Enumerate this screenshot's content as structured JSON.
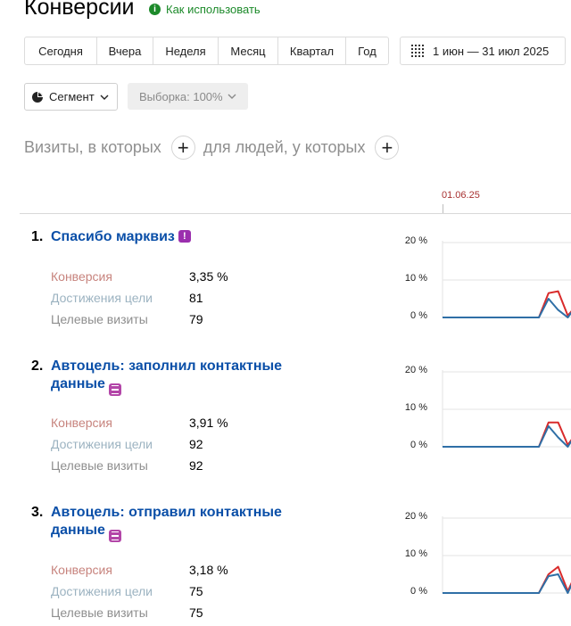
{
  "header": {
    "title": "Конверсии",
    "help_icon": "info-icon",
    "help_label": "Как использовать"
  },
  "periods": [
    "Сегодня",
    "Вчера",
    "Неделя",
    "Месяц",
    "Квартал",
    "Год"
  ],
  "date_range": {
    "icon": "calendar-icon",
    "label": "1 июн — 31 июл 2025"
  },
  "segment": {
    "icon": "pie-icon",
    "label": "Сегмент"
  },
  "sample": {
    "label": "Выборка: 100%"
  },
  "filter": {
    "visits_label": "Визиты, в которых",
    "people_label": "для людей, у которых",
    "add_symbol": "+"
  },
  "chart_header": {
    "first_date": "01.06.25"
  },
  "metric_labels": {
    "conversion": "Конверсия",
    "reaches": "Достижения цели",
    "visits": "Целевые визиты"
  },
  "colors": {
    "conversion_line": "#d92b2b",
    "visits_line": "#2f6fa6",
    "link": "#0a4fa8",
    "accent_green": "#1c8a2a"
  },
  "goals": [
    {
      "number": "1.",
      "name_lines": [
        "Спасибо марквиз"
      ],
      "badge": "!",
      "badge_icon": "alert-badge-icon",
      "conversion": "3,35 %",
      "reaches": "81",
      "visits": "79"
    },
    {
      "number": "2.",
      "name_lines": [
        "Автоцель: заполнил контактные",
        "данные"
      ],
      "badge": "",
      "badge_icon": "form-badge-icon",
      "conversion": "3,91 %",
      "reaches": "92",
      "visits": "92"
    },
    {
      "number": "3.",
      "name_lines": [
        "Автоцель: отправил контактные",
        "данные"
      ],
      "badge": "",
      "badge_icon": "form-badge-icon",
      "conversion": "3,18 %",
      "reaches": "75",
      "visits": "75"
    }
  ],
  "chart_data": [
    {
      "type": "line",
      "y_ticks": [
        "20 %",
        "10 %",
        "0 %"
      ],
      "ylim": [
        0,
        20
      ],
      "x": [
        1,
        2,
        3,
        4,
        5,
        6,
        7,
        8,
        9,
        10,
        11,
        12,
        13,
        14,
        15
      ],
      "series": [
        {
          "color": "#d92b2b",
          "values": [
            0,
            0,
            0,
            0,
            0,
            0,
            0,
            0,
            0,
            0,
            0,
            6.5,
            7,
            0.5,
            3.5
          ]
        },
        {
          "color": "#2f6fa6",
          "values": [
            0,
            0,
            0,
            0,
            0,
            0,
            0,
            0,
            0,
            0,
            0,
            5,
            2,
            0,
            3.5
          ]
        }
      ]
    },
    {
      "type": "line",
      "y_ticks": [
        "20 %",
        "10 %",
        "0 %"
      ],
      "ylim": [
        0,
        20
      ],
      "x": [
        1,
        2,
        3,
        4,
        5,
        6,
        7,
        8,
        9,
        10,
        11,
        12,
        13,
        14,
        15
      ],
      "series": [
        {
          "color": "#d92b2b",
          "values": [
            0,
            0,
            0,
            0,
            0,
            0,
            0,
            0,
            0,
            0,
            0,
            6.5,
            6.5,
            0.5,
            4
          ]
        },
        {
          "color": "#2f6fa6",
          "values": [
            0,
            0,
            0,
            0,
            0,
            0,
            0,
            0,
            0,
            0,
            0,
            5.5,
            2.5,
            0,
            4
          ]
        }
      ]
    },
    {
      "type": "line",
      "y_ticks": [
        "20 %",
        "10 %",
        "0 %"
      ],
      "ylim": [
        0,
        20
      ],
      "x": [
        1,
        2,
        3,
        4,
        5,
        6,
        7,
        8,
        9,
        10,
        11,
        12,
        13,
        14,
        15
      ],
      "series": [
        {
          "color": "#d92b2b",
          "values": [
            0,
            0,
            0,
            0,
            0,
            0,
            0,
            0,
            0,
            0,
            0,
            5,
            7,
            0.5,
            6
          ]
        },
        {
          "color": "#2f6fa6",
          "values": [
            0,
            0,
            0,
            0,
            0,
            0,
            0,
            0,
            0,
            0,
            0,
            4.5,
            5,
            0,
            5.5
          ]
        }
      ]
    }
  ]
}
